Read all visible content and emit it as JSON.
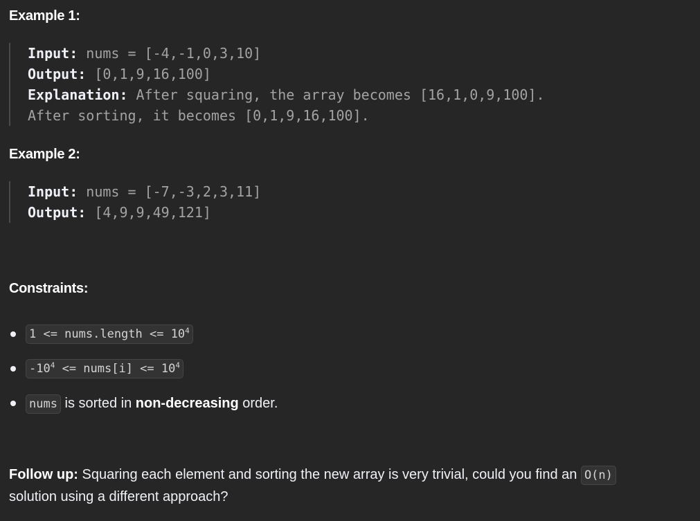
{
  "example1": {
    "heading": "Example 1:",
    "input_label": "Input:",
    "input_value": "nums = [-4,-1,0,3,10]",
    "output_label": "Output:",
    "output_value": "[0,1,9,16,100]",
    "explanation_label": "Explanation:",
    "explanation_line1": "After squaring, the array becomes [16,1,0,9,100].",
    "explanation_line2": "After sorting, it becomes [0,1,9,16,100]."
  },
  "example2": {
    "heading": "Example 2:",
    "input_label": "Input:",
    "input_value": "nums = [-7,-3,2,3,11]",
    "output_label": "Output:",
    "output_value": "[4,9,9,49,121]"
  },
  "constraints": {
    "heading": "Constraints:",
    "items": [
      {
        "code": "1 <= nums.length <= 10",
        "sup": "4"
      },
      {
        "code_pre": "-10",
        "sup1": "4",
        "code_mid": " <= nums[i] <= 10",
        "sup2": "4"
      },
      {
        "code": "nums",
        "text_pre": " is sorted in ",
        "bold": "non-decreasing",
        "text_post": " order."
      }
    ]
  },
  "followup": {
    "label": "Follow up:",
    "text_pre": " Squaring each element and sorting the new array is very trivial, could you find an ",
    "code": "O(n)",
    "text_post": " solution using a different approach?"
  }
}
